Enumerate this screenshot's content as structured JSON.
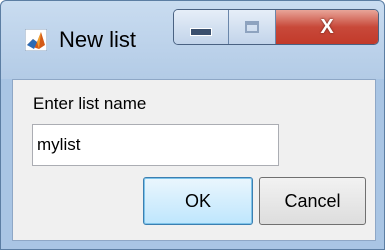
{
  "window": {
    "title": "New list"
  },
  "colors": {
    "title_bar": "#b9d1ea",
    "close_button": "#c8493a",
    "ok_button_border": "#3c7fb1"
  },
  "icons": {
    "app": "matlab-icon",
    "minimize": "minimize-icon",
    "maximize": "maximize-icon",
    "close": "close-icon"
  },
  "caption": {
    "close_glyph": "X"
  },
  "form": {
    "prompt": "Enter list name",
    "input_value": "mylist"
  },
  "buttons": {
    "ok": "OK",
    "cancel": "Cancel"
  }
}
